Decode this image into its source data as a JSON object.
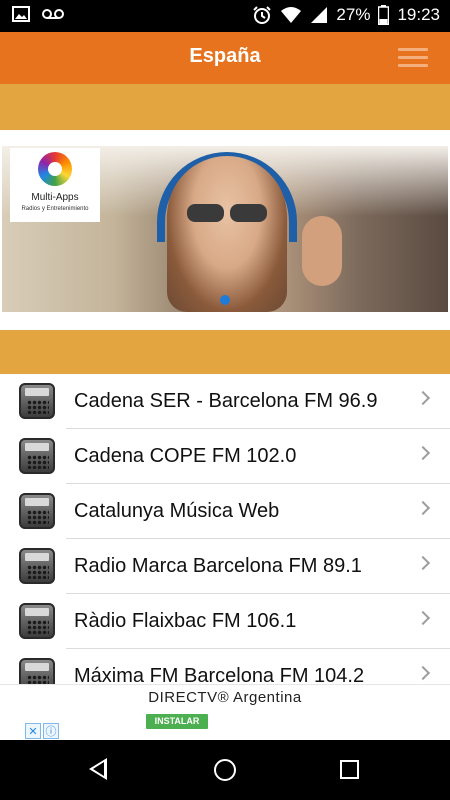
{
  "status_bar": {
    "battery_percent": "27%",
    "time": "19:23",
    "icons": [
      "image-icon",
      "voicemail-icon",
      "alarm-icon",
      "wifi-icon",
      "signal-icon",
      "battery-icon"
    ]
  },
  "app_bar": {
    "title": "España",
    "menu_icon": "hamburger-menu-icon"
  },
  "banner": {
    "logo_name": "Multi-Apps",
    "logo_subtitle": "Radios y Entretenimiento",
    "indicator_active": 1
  },
  "stations": [
    {
      "label": "Cadena SER - Barcelona FM 96.9"
    },
    {
      "label": "Cadena COPE FM 102.0"
    },
    {
      "label": "Catalunya Música Web"
    },
    {
      "label": "Radio Marca Barcelona FM 89.1"
    },
    {
      "label": "Ràdio Flaixbac FM 106.1"
    },
    {
      "label": "Máxima FM Barcelona FM 104.2"
    }
  ],
  "ad": {
    "title": "DIRECTV® Argentina",
    "install_label": "INSTALAR",
    "adchoices_icons": [
      "close-icon",
      "info-icon"
    ]
  },
  "colors": {
    "app_bar": "#e8731f",
    "band": "#e2a540",
    "install": "#4caf50"
  }
}
